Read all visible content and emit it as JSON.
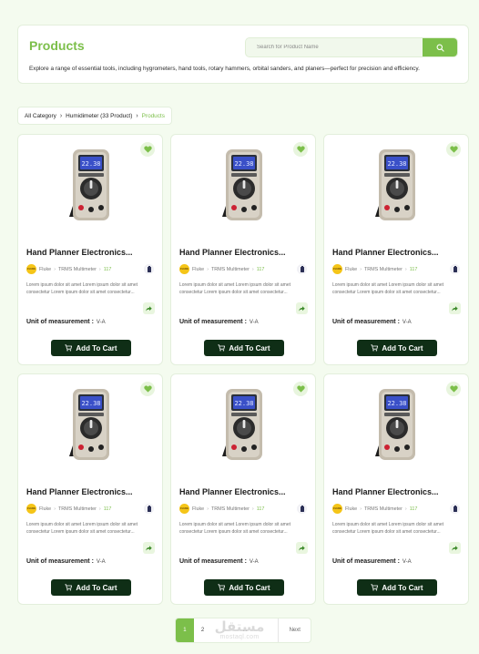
{
  "header": {
    "title": "Products",
    "search_placeholder": "Search for Product Name",
    "description": "Explore a range of essential tools, including hygrometers, hand tools, rotary hammers, orbital sanders, and planers—perfect for precision and efficiency."
  },
  "breadcrumb": [
    "All Category",
    "Humidimeter (33 Product)",
    "Products"
  ],
  "products": [
    {
      "title": "Hand Planner Electronics...",
      "brand": "Fluke",
      "category": "TRMS Multimeter",
      "model": "117",
      "description": "Lorem ipsum dolor sit amet Lorem ipsum dolor sit amet consectetur Lorem ipsum dolor sit amet consectetur...",
      "uom_label": "Unit of measurement :",
      "uom_value": "V-A",
      "button": "Add To Cart",
      "favorited": true
    },
    {
      "title": "Hand Planner Electronics...",
      "brand": "Fluke",
      "category": "TRMS Multimeter",
      "model": "117",
      "description": "Lorem ipsum dolor sit amet Lorem ipsum dolor sit amet consectetur Lorem ipsum dolor sit amet consectetur...",
      "uom_label": "Unit of measurement :",
      "uom_value": "V-A",
      "button": "Add To Cart",
      "favorited": true
    },
    {
      "title": "Hand Planner Electronics...",
      "brand": "Fluke",
      "category": "TRMS Multimeter",
      "model": "117",
      "description": "Lorem ipsum dolor sit amet Lorem ipsum dolor sit amet consectetur Lorem ipsum dolor sit amet consectetur...",
      "uom_label": "Unit of measurement :",
      "uom_value": "V-A",
      "button": "Add To Cart",
      "favorited": true
    },
    {
      "title": "Hand Planner Electronics...",
      "brand": "Fluke",
      "category": "TRMS Multimeter",
      "model": "117",
      "description": "Lorem ipsum dolor sit amet Lorem ipsum dolor sit amet consectetur Lorem ipsum dolor sit amet consectetur...",
      "uom_label": "Unit of measurement :",
      "uom_value": "V-A",
      "button": "Add To Cart",
      "favorited": true
    },
    {
      "title": "Hand Planner Electronics...",
      "brand": "Fluke",
      "category": "TRMS Multimeter",
      "model": "117",
      "description": "Lorem ipsum dolor sit amet Lorem ipsum dolor sit amet consectetur Lorem ipsum dolor sit amet consectetur...",
      "uom_label": "Unit of measurement :",
      "uom_value": "V-A",
      "button": "Add To Cart",
      "favorited": true
    },
    {
      "title": "Hand Planner Electronics...",
      "brand": "Fluke",
      "category": "TRMS Multimeter",
      "model": "117",
      "description": "Lorem ipsum dolor sit amet Lorem ipsum dolor sit amet consectetur Lorem ipsum dolor sit amet consectetur...",
      "uom_label": "Unit of measurement :",
      "uom_value": "V-A",
      "button": "Add To Cart",
      "favorited": true
    }
  ],
  "pagination": {
    "pages": [
      "1",
      "2"
    ],
    "current": "1",
    "ellipsis": "...",
    "next": "Next"
  },
  "watermark": {
    "text": "مستقل",
    "sub": "mostaql.com"
  },
  "icons": {
    "search": "search-icon",
    "favorite": "heart-icon",
    "battery": "battery-icon",
    "share": "share-icon",
    "cart": "cart-icon",
    "chevron": "chevron-right-icon",
    "brand_logo": "fluke-logo"
  },
  "colors": {
    "accent": "#7cbf4a",
    "button_dark": "#0f2e16",
    "background": "#f4fbef",
    "brand_yellow": "#f5c518"
  },
  "brand_logo_text": "FLUKE"
}
